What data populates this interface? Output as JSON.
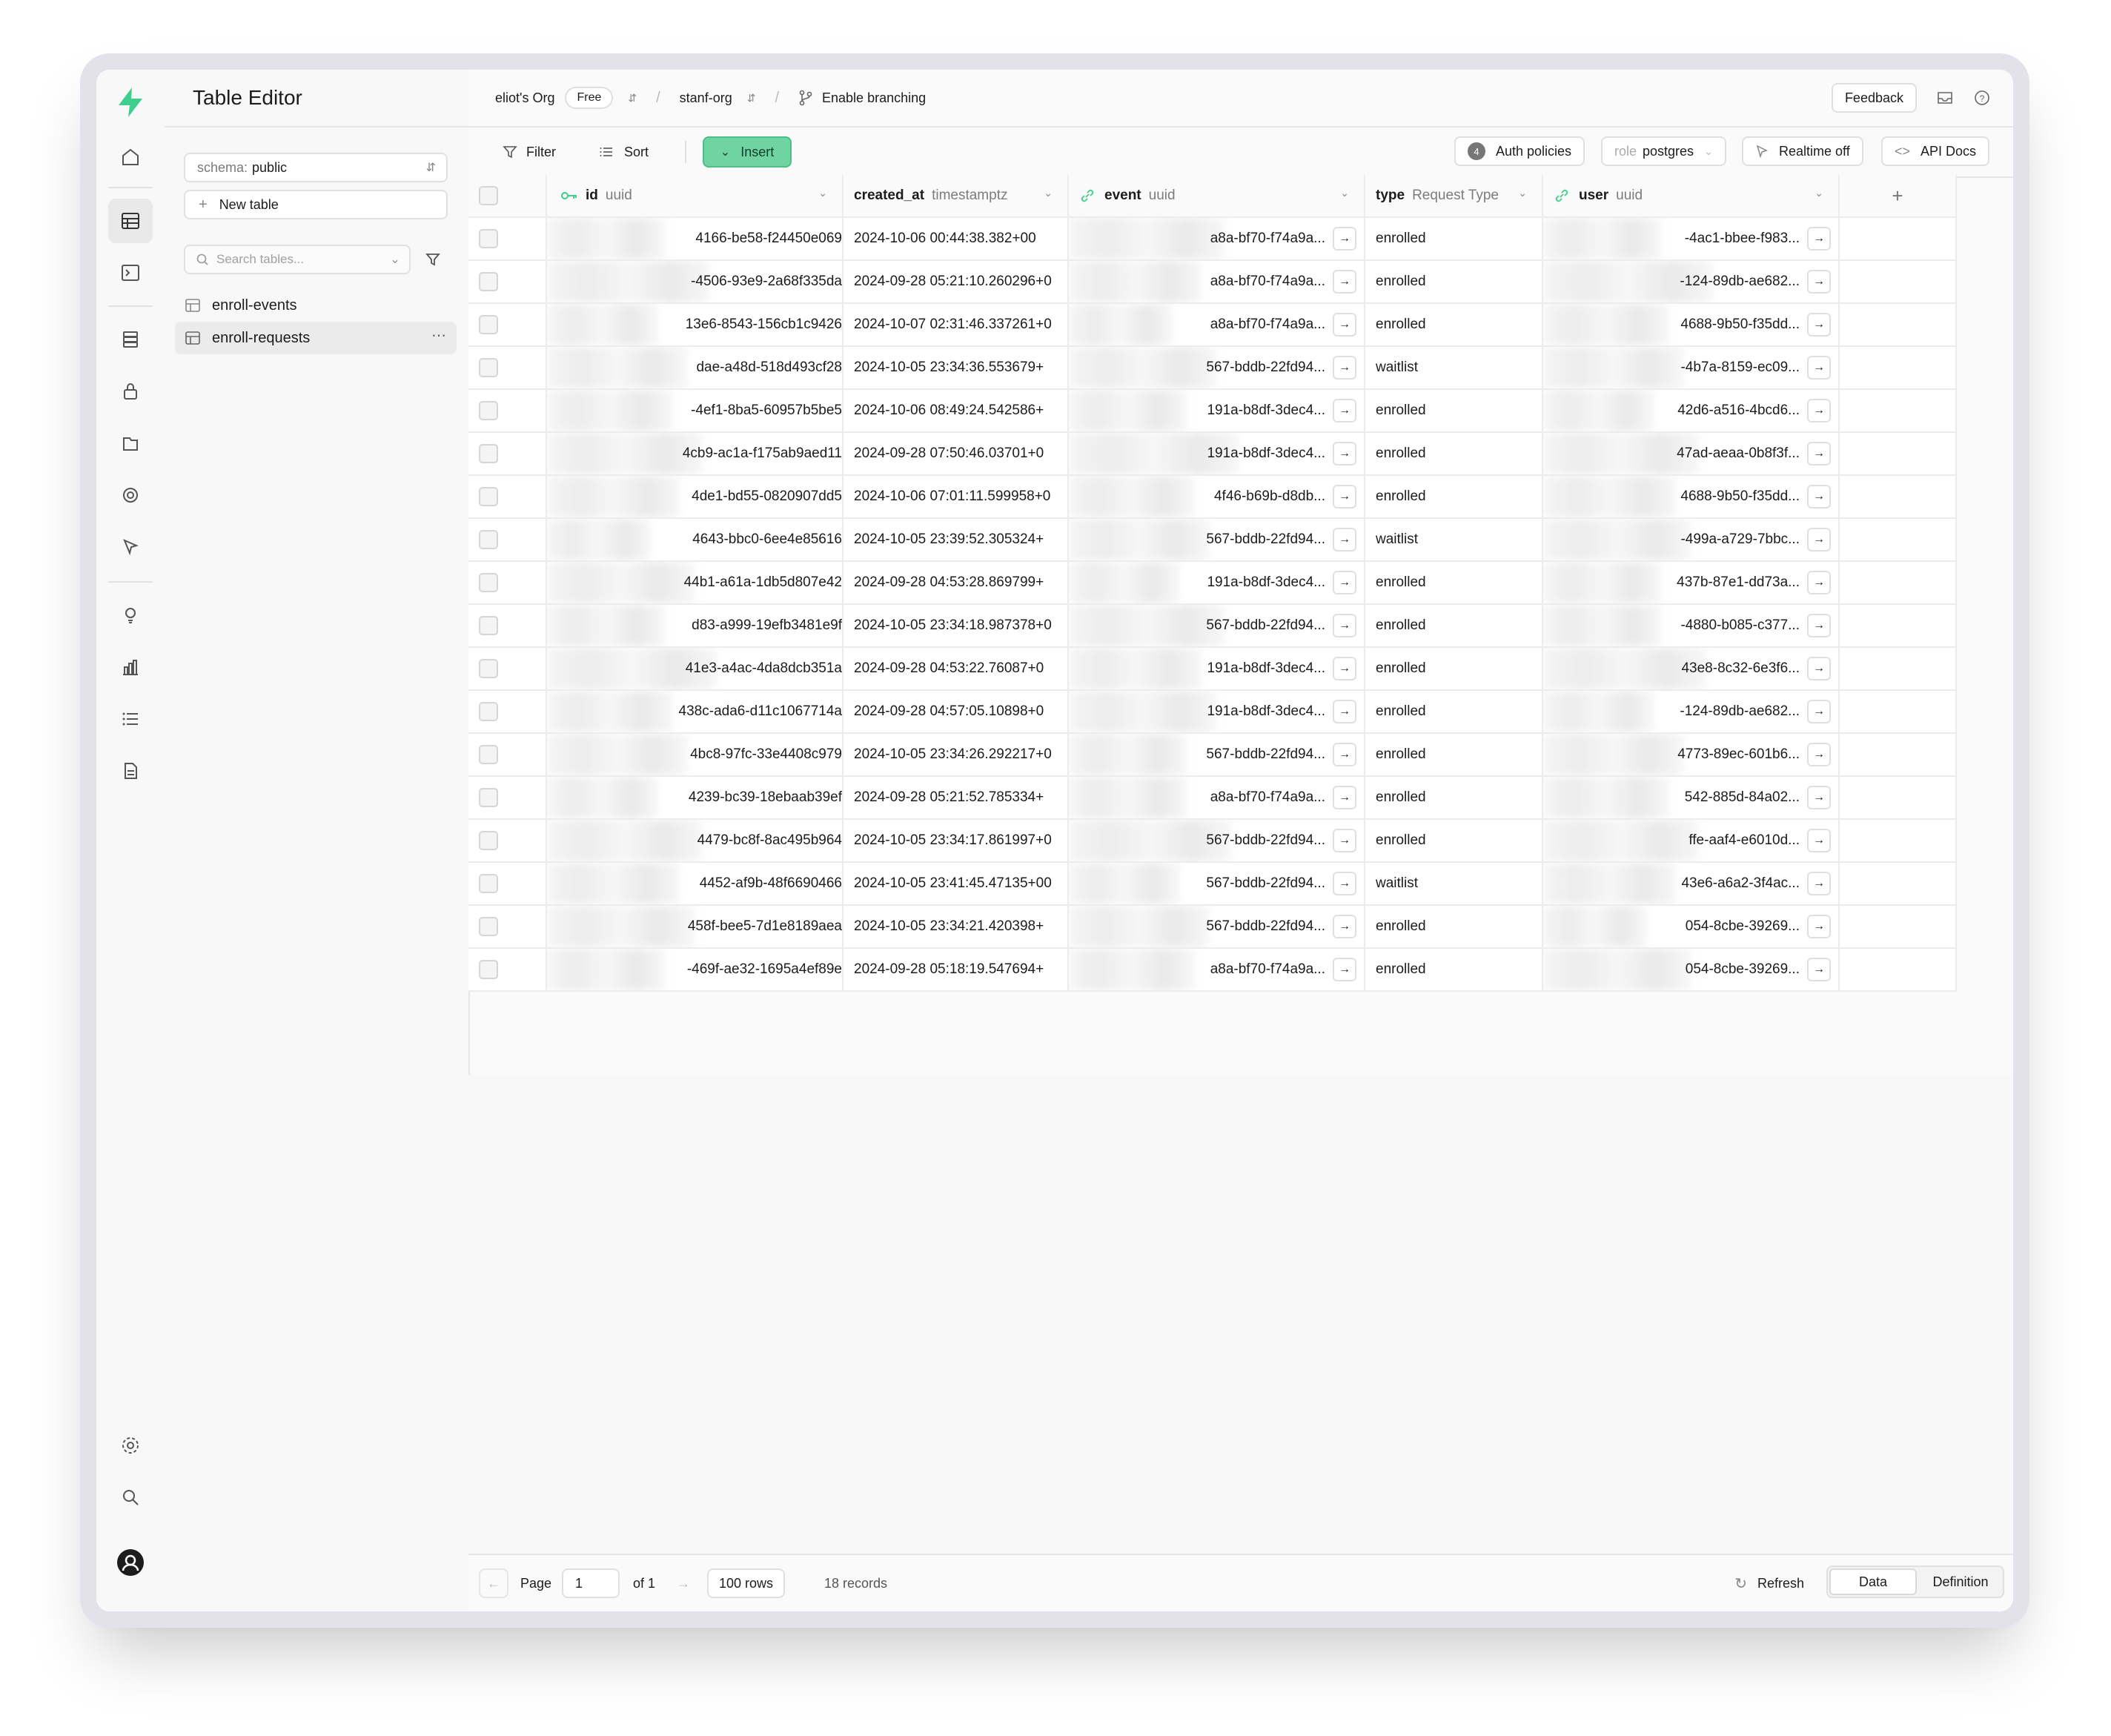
{
  "app": {
    "title": "Table Editor",
    "brand_color": "#3ecf8e"
  },
  "sidebar": {
    "schema_label": "schema:",
    "schema_value": "public",
    "new_table_label": "New table",
    "search_placeholder": "Search tables...",
    "tables": [
      {
        "name": "enroll-events",
        "active": false
      },
      {
        "name": "enroll-requests",
        "active": true
      }
    ]
  },
  "topbar": {
    "org": "eliot's Org",
    "plan": "Free",
    "project": "stanf-org",
    "branching": "Enable branching",
    "feedback": "Feedback"
  },
  "toolbar": {
    "filter": "Filter",
    "sort": "Sort",
    "insert": "Insert",
    "auth_count": "4",
    "auth_policies": "Auth policies",
    "role_label": "role",
    "role_value": "postgres",
    "realtime": "Realtime off",
    "api_docs": "API Docs"
  },
  "grid": {
    "columns": [
      {
        "name": "id",
        "type": "uuid"
      },
      {
        "name": "created_at",
        "type": "timestamptz"
      },
      {
        "name": "event",
        "type": "uuid"
      },
      {
        "name": "type",
        "type": "Request Type"
      },
      {
        "name": "user",
        "type": "uuid"
      }
    ],
    "rows": [
      {
        "id": "4166-be58-f24450e069",
        "created_at": "2024-10-06 00:44:38.382+00",
        "event": "a8a-bf70-f74a9a...",
        "type": "enrolled",
        "user": "-4ac1-bbee-f983..."
      },
      {
        "id": "-4506-93e9-2a68f335da",
        "created_at": "2024-09-28 05:21:10.260296+0",
        "event": "a8a-bf70-f74a9a...",
        "type": "enrolled",
        "user": "-124-89db-ae682..."
      },
      {
        "id": "13e6-8543-156cb1c9426",
        "created_at": "2024-10-07 02:31:46.337261+0",
        "event": "a8a-bf70-f74a9a...",
        "type": "enrolled",
        "user": "4688-9b50-f35dd..."
      },
      {
        "id": "dae-a48d-518d493cf28",
        "created_at": "2024-10-05 23:34:36.553679+",
        "event": "567-bddb-22fd94...",
        "type": "waitlist",
        "user": "-4b7a-8159-ec09..."
      },
      {
        "id": "-4ef1-8ba5-60957b5be5",
        "created_at": "2024-10-06 08:49:24.542586+",
        "event": "191a-b8df-3dec4...",
        "type": "enrolled",
        "user": "42d6-a516-4bcd6..."
      },
      {
        "id": "4cb9-ac1a-f175ab9aed11",
        "created_at": "2024-09-28 07:50:46.03701+0",
        "event": "191a-b8df-3dec4...",
        "type": "enrolled",
        "user": "47ad-aeaa-0b8f3f..."
      },
      {
        "id": "4de1-bd55-0820907dd5",
        "created_at": "2024-10-06 07:01:11.599958+0",
        "event": "4f46-b69b-d8db...",
        "type": "enrolled",
        "user": "4688-9b50-f35dd..."
      },
      {
        "id": "4643-bbc0-6ee4e85616",
        "created_at": "2024-10-05 23:39:52.305324+",
        "event": "567-bddb-22fd94...",
        "type": "waitlist",
        "user": "-499a-a729-7bbc..."
      },
      {
        "id": "44b1-a61a-1db5d807e42",
        "created_at": "2024-09-28 04:53:28.869799+",
        "event": "191a-b8df-3dec4...",
        "type": "enrolled",
        "user": "437b-87e1-dd73a..."
      },
      {
        "id": "d83-a999-19efb3481e9f",
        "created_at": "2024-10-05 23:34:18.987378+0",
        "event": "567-bddb-22fd94...",
        "type": "enrolled",
        "user": "-4880-b085-c377..."
      },
      {
        "id": "41e3-a4ac-4da8dcb351a",
        "created_at": "2024-09-28 04:53:22.76087+0",
        "event": "191a-b8df-3dec4...",
        "type": "enrolled",
        "user": "43e8-8c32-6e3f6..."
      },
      {
        "id": "438c-ada6-d11c1067714a",
        "created_at": "2024-09-28 04:57:05.10898+0",
        "event": "191a-b8df-3dec4...",
        "type": "enrolled",
        "user": "-124-89db-ae682..."
      },
      {
        "id": "4bc8-97fc-33e4408c979",
        "created_at": "2024-10-05 23:34:26.292217+0",
        "event": "567-bddb-22fd94...",
        "type": "enrolled",
        "user": "4773-89ec-601b6..."
      },
      {
        "id": "4239-bc39-18ebaab39ef",
        "created_at": "2024-09-28 05:21:52.785334+",
        "event": "a8a-bf70-f74a9a...",
        "type": "enrolled",
        "user": "542-885d-84a02..."
      },
      {
        "id": "4479-bc8f-8ac495b964",
        "created_at": "2024-10-05 23:34:17.861997+0",
        "event": "567-bddb-22fd94...",
        "type": "enrolled",
        "user": "ffe-aaf4-e6010d..."
      },
      {
        "id": "4452-af9b-48f6690466",
        "created_at": "2024-10-05 23:41:45.47135+00",
        "event": "567-bddb-22fd94...",
        "type": "waitlist",
        "user": "43e6-a6a2-3f4ac..."
      },
      {
        "id": "458f-bee5-7d1e8189aea",
        "created_at": "2024-10-05 23:34:21.420398+",
        "event": "567-bddb-22fd94...",
        "type": "enrolled",
        "user": "054-8cbe-39269..."
      },
      {
        "id": "-469f-ae32-1695a4ef89e",
        "created_at": "2024-09-28 05:18:19.547694+",
        "event": "a8a-bf70-f74a9a...",
        "type": "enrolled",
        "user": "054-8cbe-39269..."
      }
    ]
  },
  "footer": {
    "page_label": "Page",
    "page_value": "1",
    "of_label": "of 1",
    "rows_select": "100 rows",
    "records": "18 records",
    "refresh": "Refresh",
    "view_data": "Data",
    "view_definition": "Definition"
  }
}
